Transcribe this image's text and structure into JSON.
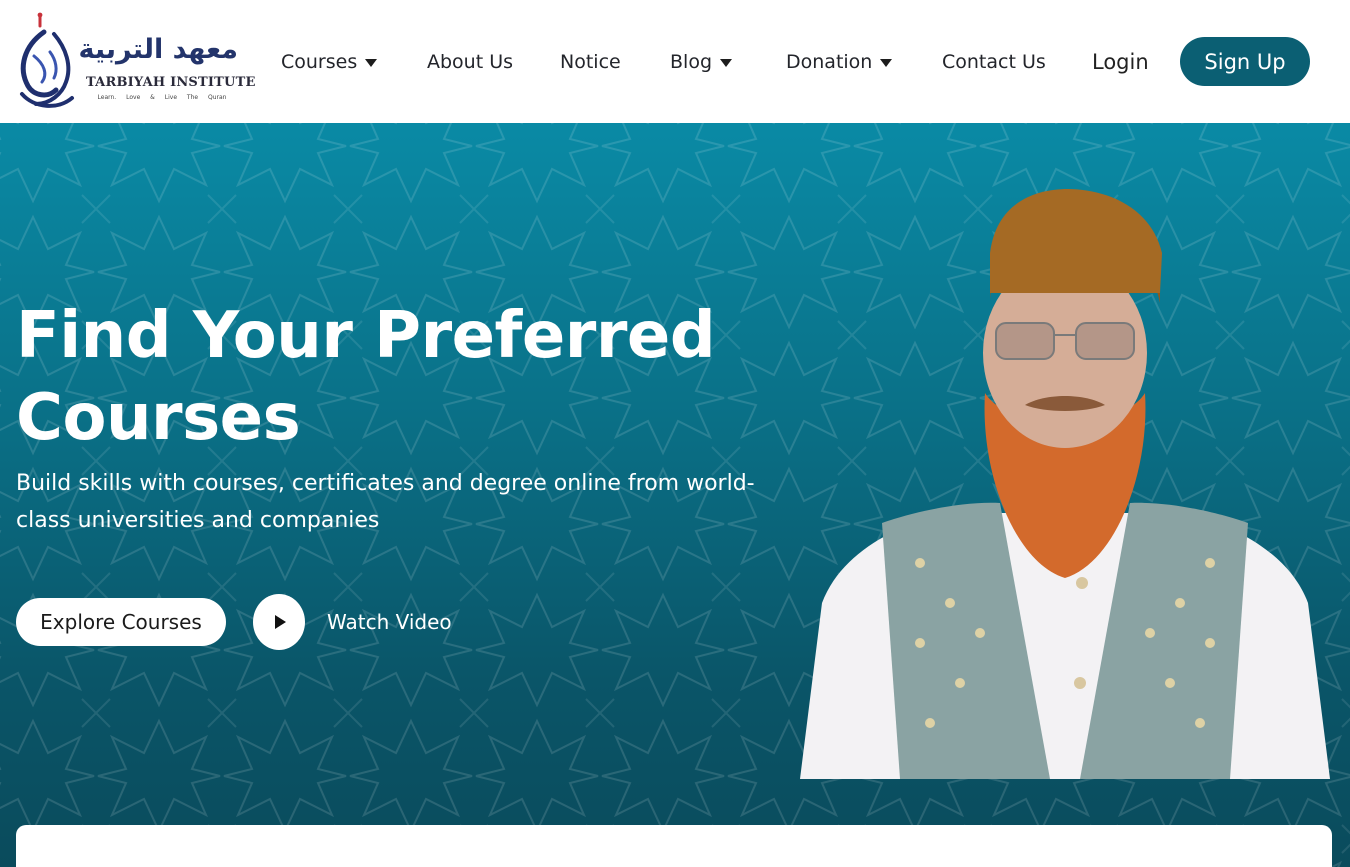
{
  "logo": {
    "arabic": "معهد التربية",
    "name": "TARBIYAH INSTITUTE",
    "tagline": "Learn. Love & Live The Quran"
  },
  "nav": {
    "courses": "Courses",
    "about": "About Us",
    "notice": "Notice",
    "blog": "Blog",
    "donation": "Donation",
    "contact": "Contact Us",
    "login": "Login",
    "signup": "Sign Up"
  },
  "hero": {
    "title": "Find Your Preferred Courses",
    "subtitle": "Build skills with courses, certificates and degree online from world-class universities and companies",
    "explore": "Explore Courses",
    "watch": "Watch Video"
  },
  "colors": {
    "brand": "#0b5f73",
    "hero_top": "#0a8aa5",
    "hero_bottom": "#0a4b5c",
    "logo_navy": "#23346b"
  },
  "icons": {
    "play": "play-icon",
    "caret": "caret-down-icon"
  }
}
